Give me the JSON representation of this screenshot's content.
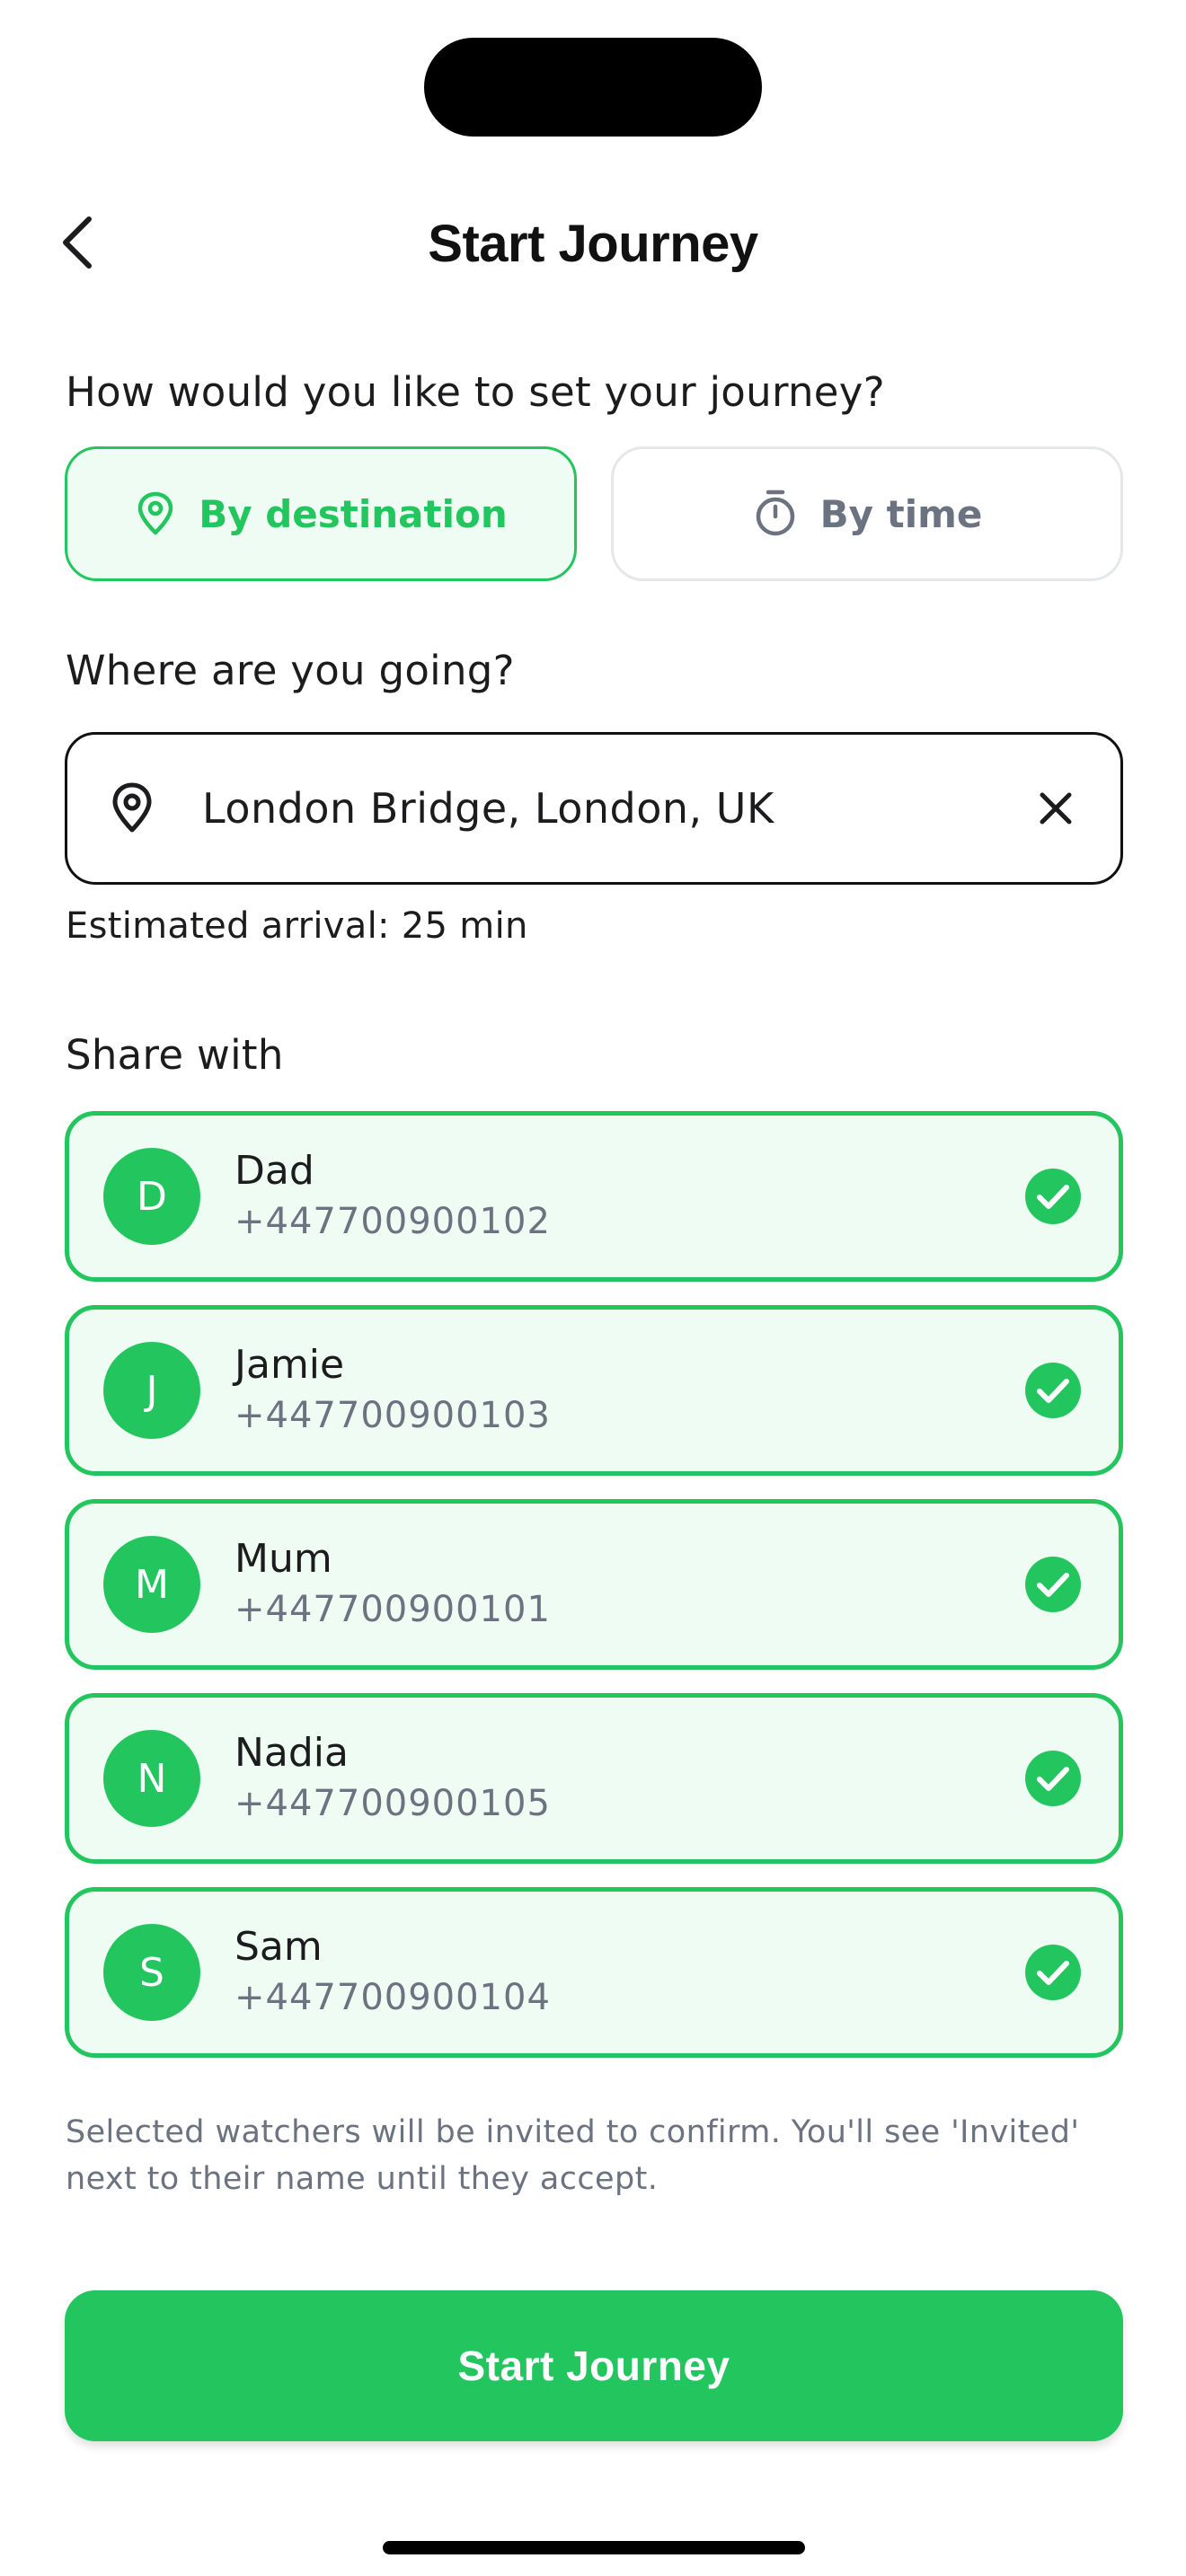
{
  "header": {
    "title": "Start Journey"
  },
  "mode_section": {
    "question": "How would you like to set your journey?",
    "options": [
      {
        "label": "By destination",
        "icon": "map-pin-icon",
        "selected": true
      },
      {
        "label": "By time",
        "icon": "timer-icon",
        "selected": false
      }
    ]
  },
  "destination": {
    "label": "Where are you going?",
    "value": "London Bridge, London, UK",
    "eta": "Estimated arrival: 25 min"
  },
  "share": {
    "label": "Share with",
    "contacts": [
      {
        "initial": "D",
        "name": "Dad",
        "phone": "+447700900102",
        "selected": true
      },
      {
        "initial": "J",
        "name": "Jamie",
        "phone": "+447700900103",
        "selected": true
      },
      {
        "initial": "M",
        "name": "Mum",
        "phone": "+447700900101",
        "selected": true
      },
      {
        "initial": "N",
        "name": "Nadia",
        "phone": "+447700900105",
        "selected": true
      },
      {
        "initial": "S",
        "name": "Sam",
        "phone": "+447700900104",
        "selected": true
      }
    ],
    "note": "Selected watchers will be invited to confirm. You'll see 'Invited' next to their name until they accept."
  },
  "primary_action": {
    "label": "Start Journey"
  },
  "colors": {
    "accent": "#22c55e",
    "accent_bg": "#effcf3",
    "muted_text": "#6b7280"
  }
}
